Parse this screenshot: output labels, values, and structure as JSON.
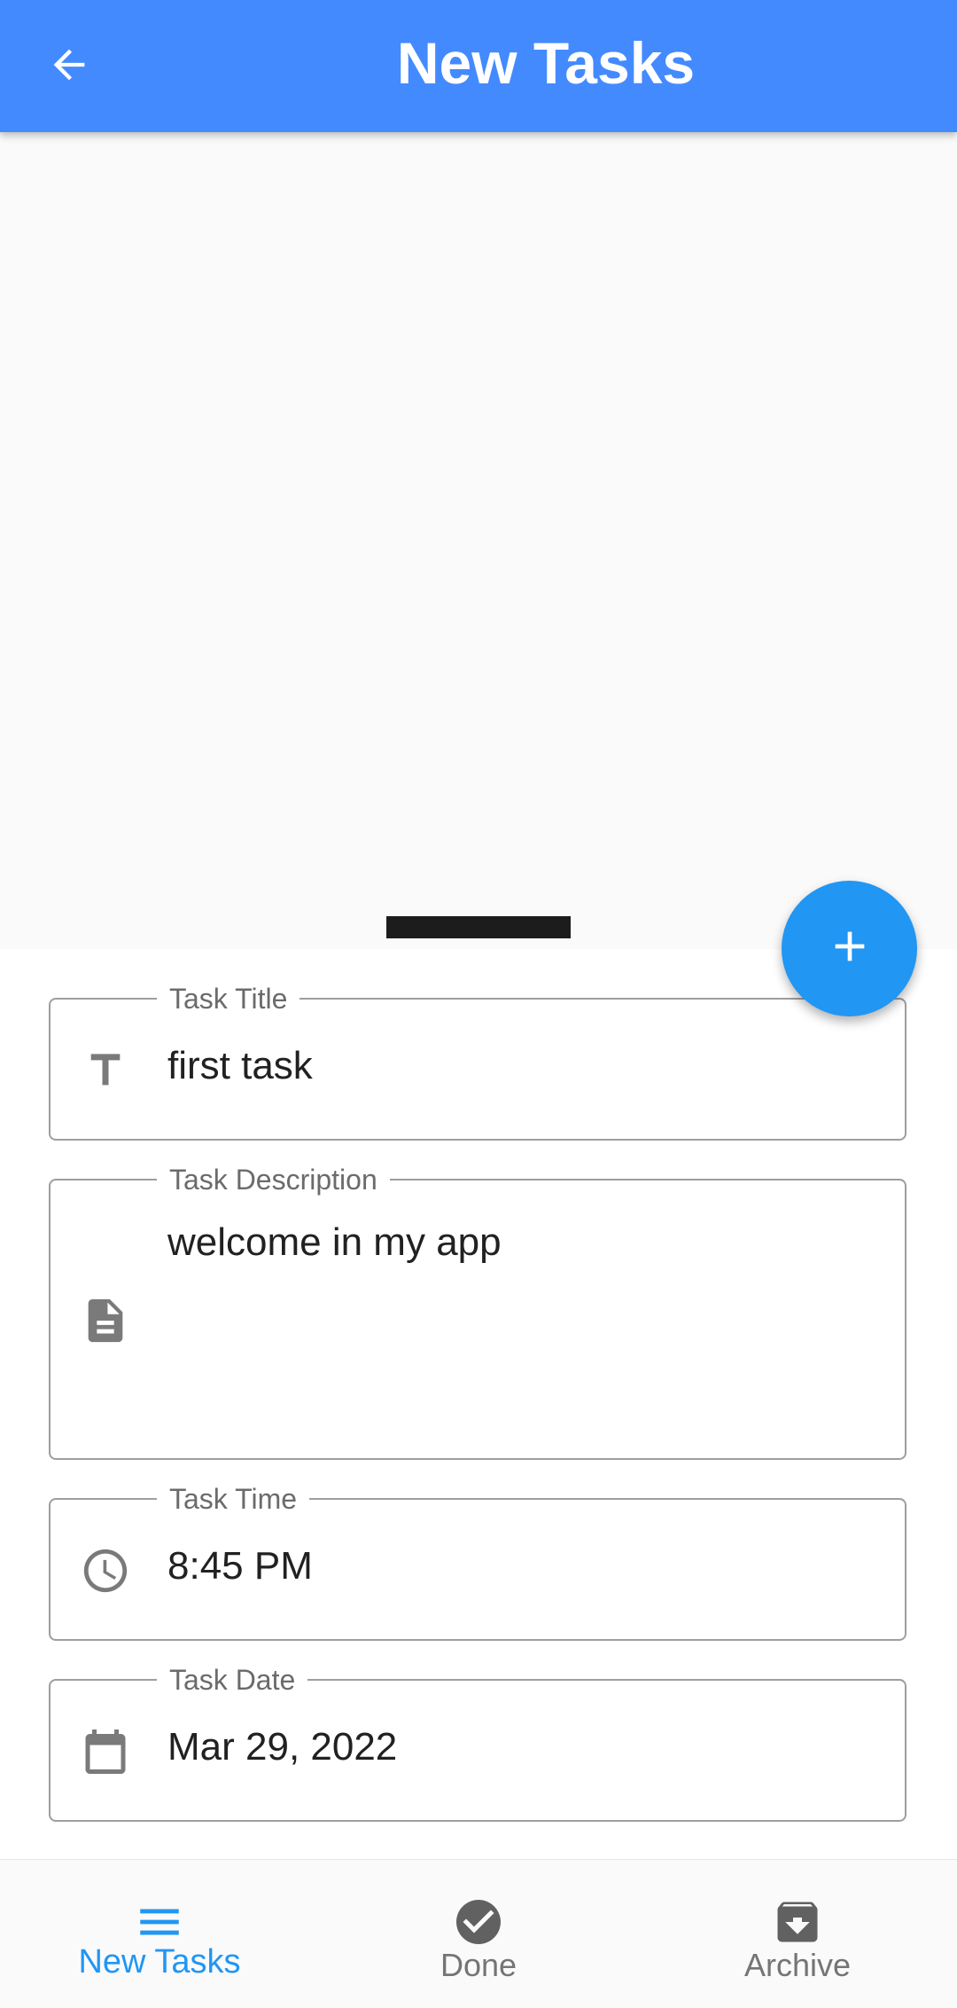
{
  "app_bar": {
    "title": "New Tasks",
    "back_icon": "arrow-back-icon",
    "background": "#448aff"
  },
  "fab": {
    "icon": "plus-icon",
    "color": "#2196f3"
  },
  "form": {
    "task_title": {
      "label": "Task Title",
      "value": "first task",
      "icon": "title-icon"
    },
    "task_description": {
      "label": "Task Description",
      "value": "welcome in my app",
      "icon": "document-icon"
    },
    "task_time": {
      "label": "Task Time",
      "value": "8:45 PM",
      "icon": "clock-icon"
    },
    "task_date": {
      "label": "Task Date",
      "value": "Mar 29, 2022",
      "icon": "calendar-icon"
    }
  },
  "bottom_nav": {
    "items": [
      {
        "label": "New Tasks",
        "icon": "menu-icon",
        "active": true
      },
      {
        "label": "Done",
        "icon": "check-circle-icon",
        "active": false
      },
      {
        "label": "Archive",
        "icon": "archive-icon",
        "active": false
      }
    ],
    "active_color": "#2196f3",
    "inactive_color": "#757575"
  }
}
